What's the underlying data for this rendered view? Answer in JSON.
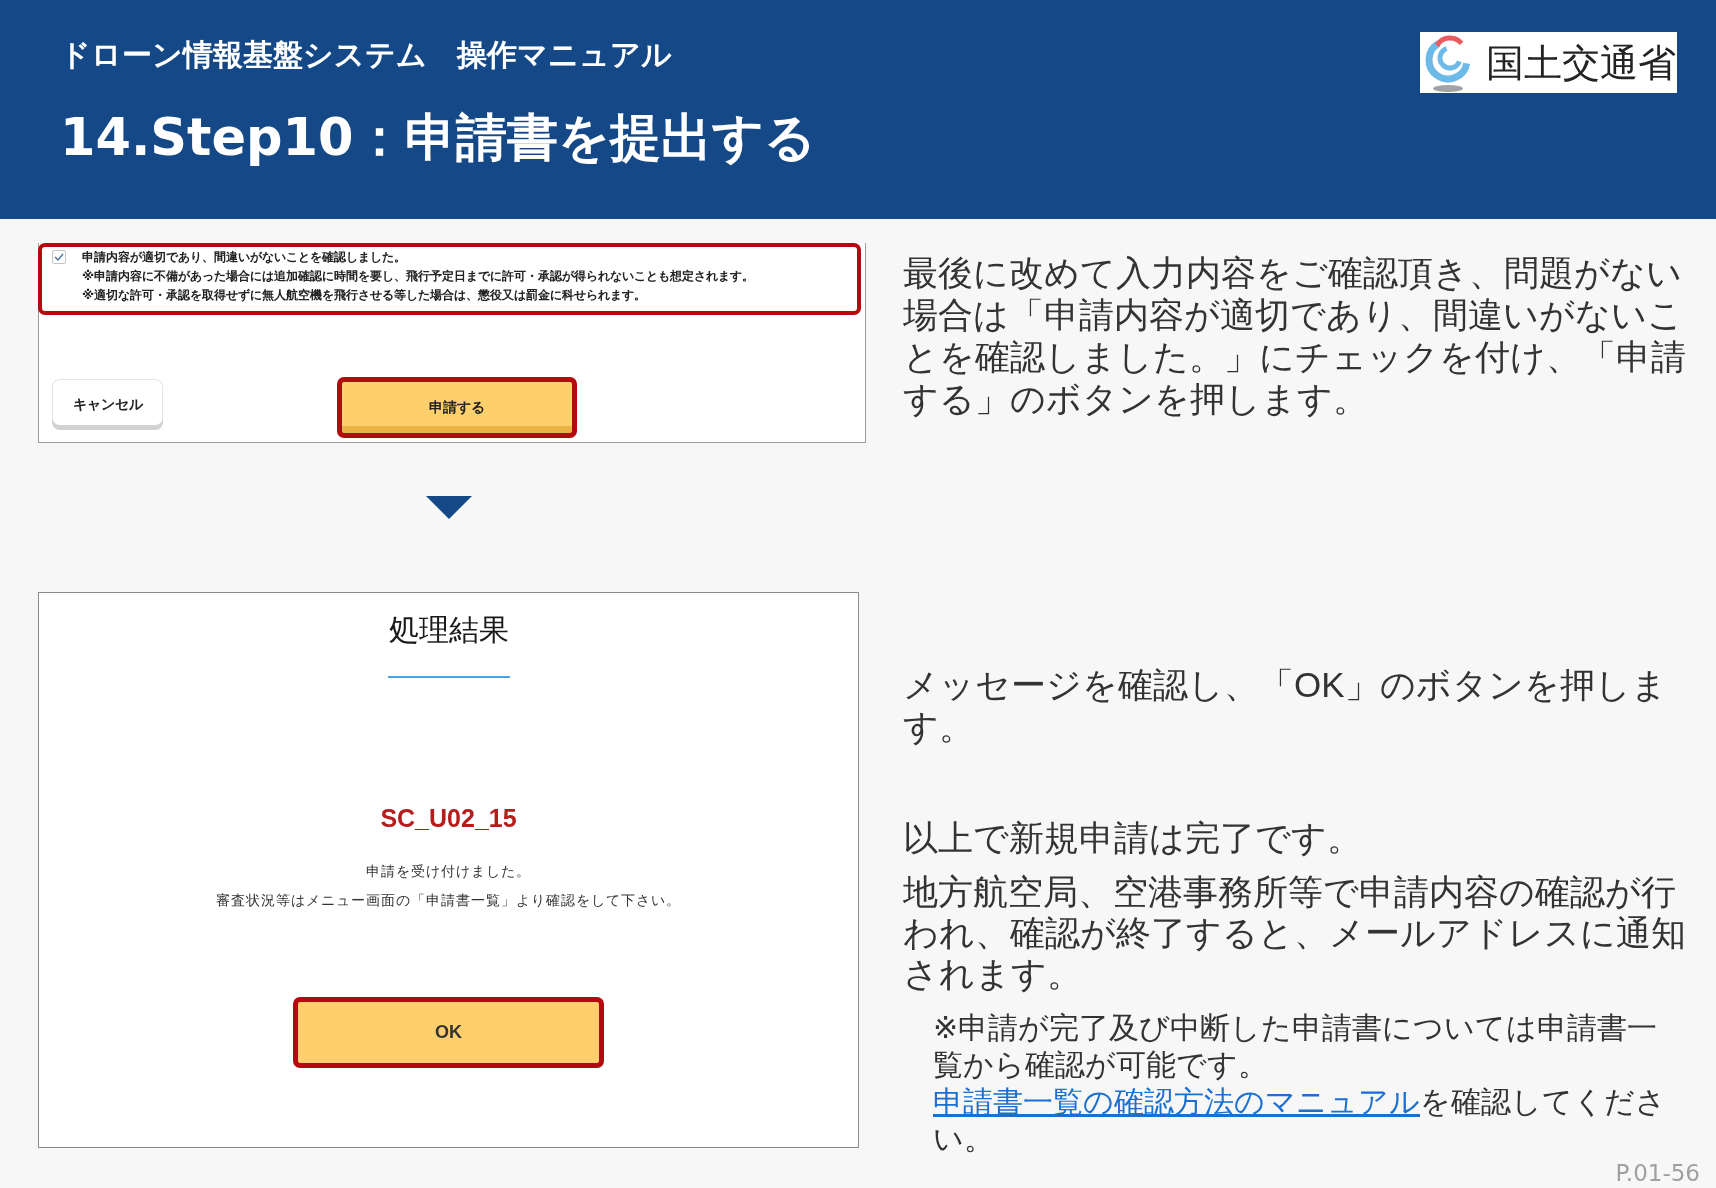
{
  "header": {
    "subtitle": "ドローン情報基盤システム　操作マニュアル",
    "title": "14.Step10：申請書を提出する",
    "logo": {
      "text": "国土交通省"
    }
  },
  "confirm_screen": {
    "agreement": {
      "highlighted": true,
      "checked": true,
      "label": "申請内容が適切であり、間違いがないことを確認しました。",
      "notes": [
        "※申請内容に不備があった場合には追加確認に時間を要し、飛行予定日までに許可・承認が得られないことも想定されます。",
        "※適切な許可・承認を取得せずに無人航空機を飛行させる等した場合は、懲役又は罰金に科せられます。"
      ]
    },
    "buttons": [
      {
        "label": "キャンセル",
        "kind": "cancel",
        "highlighted": false
      },
      {
        "label": "申請する",
        "kind": "submit",
        "highlighted": true
      }
    ]
  },
  "result_dialog": {
    "title": "処理結果",
    "code": "SC_U02_15",
    "messages": [
      "申請を受け付けました。",
      "審査状況等はメニュー画面の「申請書一覧」より確認をして下さい。"
    ],
    "button": {
      "label": "OK",
      "highlighted": true
    }
  },
  "instructions": {
    "paragraphs": [
      "最後に改めて入力内容をご確認頂き、問題がない場合は「申請内容が適切であり、間違いがないことを確認しました。」にチェックを付け、「申請する」のボタンを押します。",
      "メッセージを確認し、「OK」のボタンを押します。",
      "以上で新規申請は完了です。",
      "地方航空局、空港事務所等で申請内容の確認が行われ、確認が終了すると、メールアドレスに通知されます。"
    ],
    "note": {
      "text": "※申請が完了及び中断した申請書については申請書一覧から確認が可能です。",
      "link": "申請書一覧の確認方法のマニュアル",
      "text_after": "を確認してください。"
    }
  },
  "page_number": "P.01-56"
}
